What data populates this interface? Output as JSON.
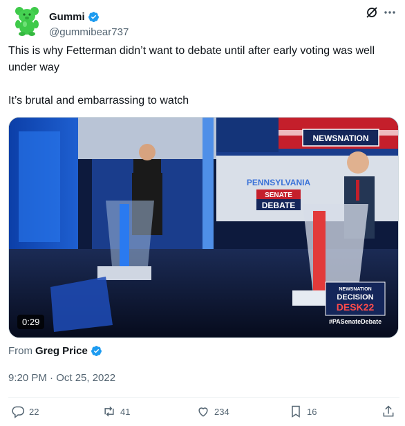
{
  "author": {
    "display_name": "Gummi",
    "handle": "@gummibear737",
    "verified": true,
    "avatar_icon": "gummy-bear-avatar"
  },
  "header_icons": [
    "grok-icon",
    "more-icon"
  ],
  "tweet": {
    "line1": "This is why Fetterman didn’t want to debate until after early voting was well under way",
    "line2": "It’s brutal and embarrassing to watch"
  },
  "media": {
    "duration": "0:29",
    "overlay_texts": {
      "network": "NEWSNATION",
      "state": "PENNSYLVANIA",
      "senate": "SENATE",
      "debate": "DEBATE",
      "decision_network": "NEWSNATION",
      "decision": "DECISION",
      "desk": "DESK22",
      "hashtag": "#PASenateDebate"
    }
  },
  "from": {
    "prefix": "From",
    "name": "Greg Price",
    "verified": true
  },
  "timestamp": "9:20 PM · Oct 25, 2022",
  "actions": {
    "replies": "22",
    "reposts": "41",
    "likes": "234",
    "bookmarks": "16"
  },
  "colors": {
    "verified_blue": "#1d9bf0",
    "secondary_text": "#536471",
    "avatar_green": "#3fca4a"
  }
}
